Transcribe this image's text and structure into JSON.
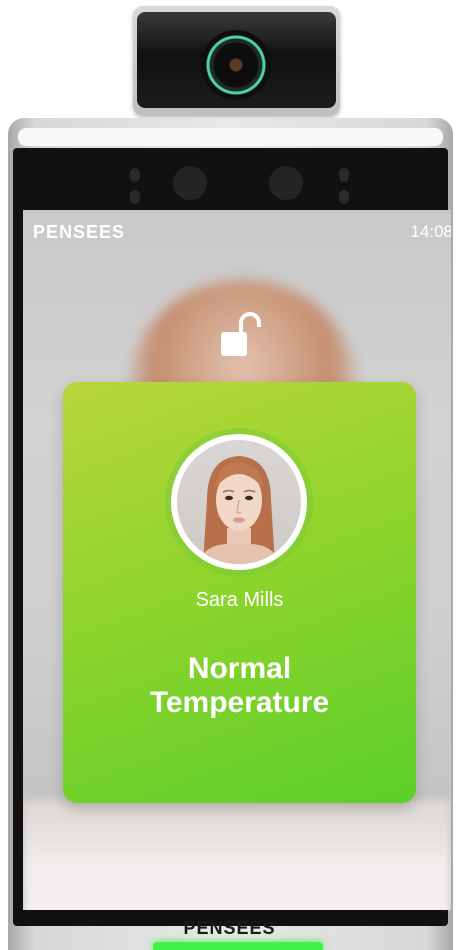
{
  "device": {
    "brand_top": "PENSEES",
    "brand_bottom": "PENSEES",
    "clock": "14:08"
  },
  "card": {
    "person_name": "Sara Mills",
    "status_line1": "Normal",
    "status_line2": "Temperature"
  },
  "icons": {
    "lock": "unlock-icon",
    "camera": "camera-lens-icon"
  },
  "colors": {
    "card_start": "#b9d63a",
    "card_end": "#5ccf2a",
    "led": "#3ef24a"
  }
}
